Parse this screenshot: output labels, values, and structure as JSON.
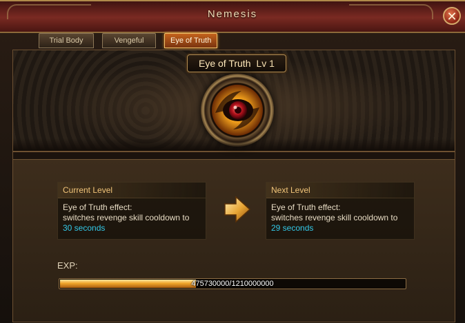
{
  "window": {
    "title": "Nemesis",
    "close_icon": "close-icon"
  },
  "tabs": [
    {
      "label": "Trial Body",
      "active": false
    },
    {
      "label": "Vengeful Soul",
      "active": false
    },
    {
      "label": "Eye of Truth",
      "active": true
    }
  ],
  "skill": {
    "name": "Eye of Truth",
    "level_label": "Lv 1",
    "icon": "eye-of-truth-icon"
  },
  "current_level": {
    "heading": "Current Level",
    "effect_line1": "Eye of Truth effect:",
    "effect_line2": "switches revenge skill cooldown to",
    "value": "30 seconds"
  },
  "next_level": {
    "heading": "Next Level",
    "effect_line1": "Eye of Truth effect:",
    "effect_line2": "switches revenge skill cooldown to",
    "value": "29 seconds"
  },
  "exp": {
    "label": "EXP:",
    "text": "475730000/1210000000",
    "progress": 0.393
  },
  "colors": {
    "accent_gold": "#f2c57a",
    "value_cyan": "#33c9e8",
    "tab_active": "#c3621c"
  }
}
